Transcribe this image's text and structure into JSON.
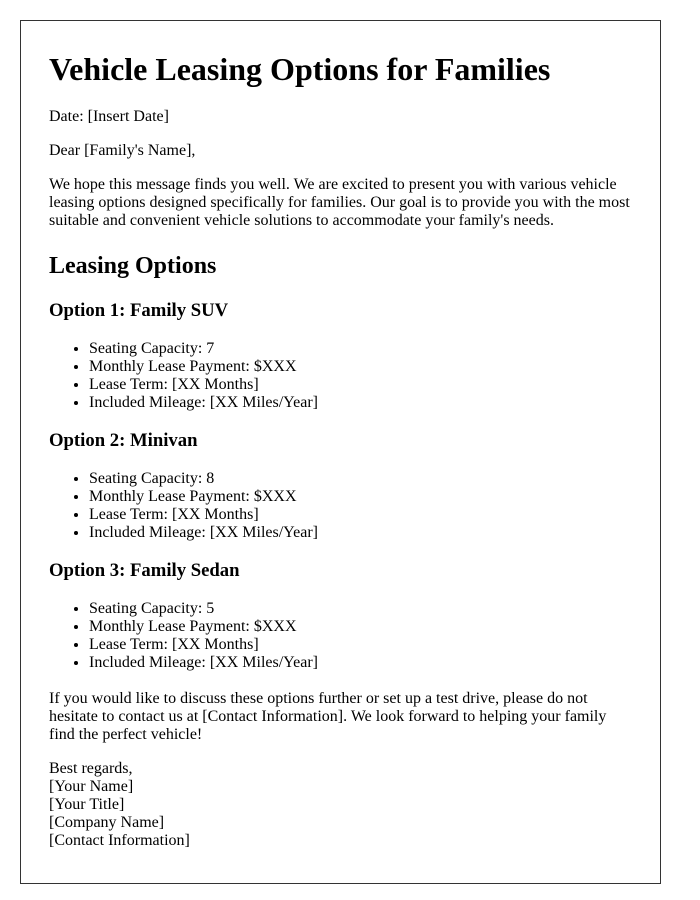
{
  "title": "Vehicle Leasing Options for Families",
  "date_line": "Date: [Insert Date]",
  "salutation": "Dear [Family's Name],",
  "intro": "We hope this message finds you well. We are excited to present you with various vehicle leasing options designed specifically for families. Our goal is to provide you with the most suitable and convenient vehicle solutions to accommodate your family's needs.",
  "section_heading": "Leasing Options",
  "options": [
    {
      "heading": "Option 1: Family SUV",
      "items": [
        "Seating Capacity: 7",
        "Monthly Lease Payment: $XXX",
        "Lease Term: [XX Months]",
        "Included Mileage: [XX Miles/Year]"
      ]
    },
    {
      "heading": "Option 2: Minivan",
      "items": [
        "Seating Capacity: 8",
        "Monthly Lease Payment: $XXX",
        "Lease Term: [XX Months]",
        "Included Mileage: [XX Miles/Year]"
      ]
    },
    {
      "heading": "Option 3: Family Sedan",
      "items": [
        "Seating Capacity: 5",
        "Monthly Lease Payment: $XXX",
        "Lease Term: [XX Months]",
        "Included Mileage: [XX Miles/Year]"
      ]
    }
  ],
  "closing_paragraph": "If you would like to discuss these options further or set up a test drive, please do not hesitate to contact us at [Contact Information]. We look forward to helping your family find the perfect vehicle!",
  "signoff": {
    "regards": "Best regards,",
    "name": "[Your Name]",
    "title": "[Your Title]",
    "company": "[Company Name]",
    "contact": "[Contact Information]"
  }
}
